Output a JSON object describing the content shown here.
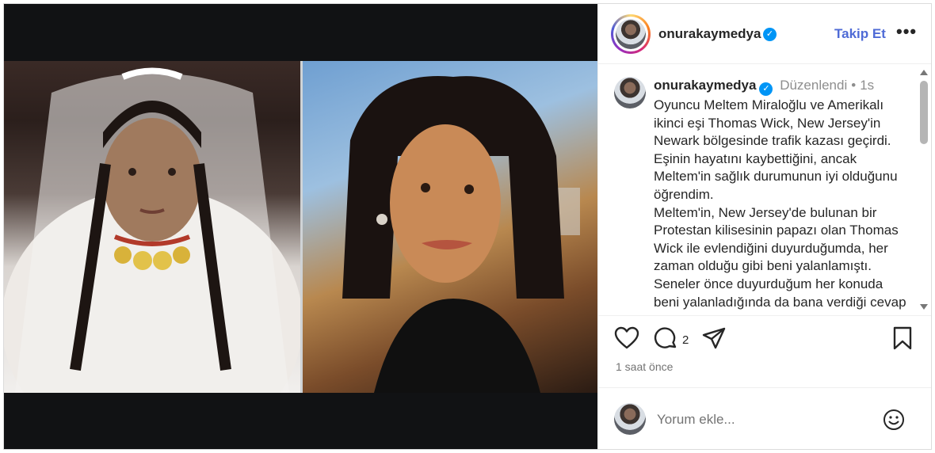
{
  "post": {
    "username": "onurakaymedya",
    "follow_label": "Takip Et",
    "more_label": "•••",
    "verified_label": "✓"
  },
  "caption": {
    "username": "onurakaymedya",
    "edited_label": "Düzenlendi",
    "separator": "•",
    "age": "1s",
    "text": "Oyuncu Meltem Miraloğlu ve Amerikalı ikinci eşi Thomas Wick, New Jersey'in Newark bölgesinde trafik kazası geçirdi. Eşinin hayatını kaybettiğini, ancak Meltem'in sağlık durumunun iyi olduğunu öğrendim.\nMeltem'in, New Jersey'de bulunan bir Protestan kilisesinin papazı olan Thomas Wick ile evlendiğini duyurduğumda, her zaman olduğu gibi beni yalanlamıştı. Seneler önce duyurduğum her konuda beni yalanladığında da bana verdiği cevap"
  },
  "actions": {
    "comment_count": "2",
    "time_ago": "1 saat önce"
  },
  "comment_box": {
    "placeholder": "Yorum ekle..."
  },
  "icons": {
    "like": "heart-icon",
    "comment": "comment-icon",
    "share": "share-icon",
    "save": "bookmark-icon",
    "emoji": "emoji-icon",
    "verified": "verified-badge-icon"
  },
  "colors": {
    "accent": "#4f6bd6",
    "verified": "#0095f6",
    "muted": "#8e8e8e"
  }
}
